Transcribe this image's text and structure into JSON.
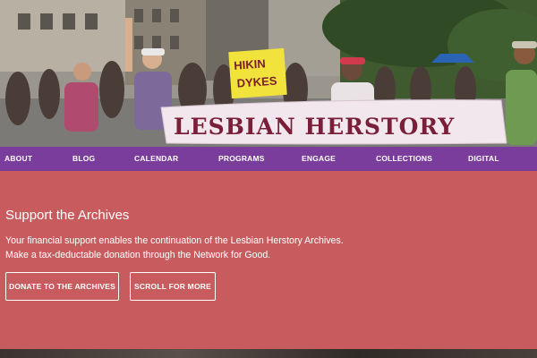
{
  "hero": {
    "banner_text": "LESBIAN HERSTORY",
    "sign_text_line1": "HIKIN",
    "sign_text_line2": "DYKES"
  },
  "nav": {
    "items": [
      {
        "label": "ABOUT"
      },
      {
        "label": "BLOG"
      },
      {
        "label": "CALENDAR"
      },
      {
        "label": "PROGRAMS"
      },
      {
        "label": "ENGAGE"
      },
      {
        "label": "COLLECTIONS"
      },
      {
        "label": "DIGITAL"
      }
    ]
  },
  "support": {
    "title": "Support the Archives",
    "text": "Your financial support enables the continuation of the Lesbian Herstory Archives. Make a tax-deductable donation through the Network for Good.",
    "donate_label": "DONATE TO THE ARCHIVES",
    "scroll_label": "SCROLL FOR MORE"
  },
  "colors": {
    "nav_bg": "#7a3d9b",
    "panel_bg": "#c75b5e",
    "banner_text": "#7a1f3a"
  }
}
